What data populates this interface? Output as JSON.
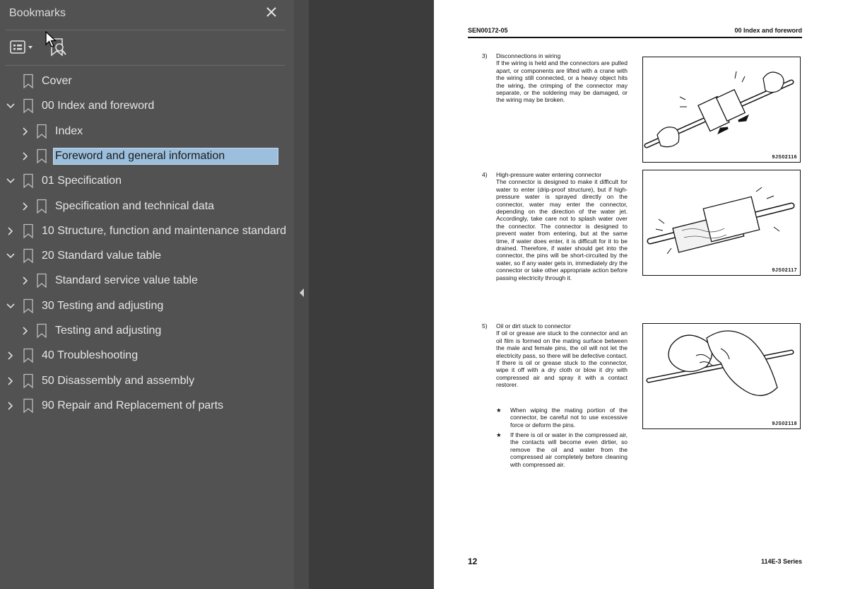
{
  "bookmarks_panel": {
    "title": "Bookmarks",
    "items": [
      {
        "label": "Cover",
        "level": 0,
        "expander": "none",
        "selected": false
      },
      {
        "label": "00 Index and foreword",
        "level": 0,
        "expander": "expanded",
        "selected": false
      },
      {
        "label": "Index",
        "level": 1,
        "expander": "collapsed",
        "selected": false
      },
      {
        "label": "Foreword and general information",
        "level": 1,
        "expander": "collapsed",
        "selected": true
      },
      {
        "label": "01 Specification",
        "level": 0,
        "expander": "expanded",
        "selected": false
      },
      {
        "label": "Specification and technical data",
        "level": 1,
        "expander": "collapsed",
        "selected": false
      },
      {
        "label": "10 Structure, function and maintenance standard",
        "level": 0,
        "expander": "collapsed",
        "selected": false
      },
      {
        "label": "20 Standard value table",
        "level": 0,
        "expander": "expanded",
        "selected": false
      },
      {
        "label": "Standard service value table",
        "level": 1,
        "expander": "collapsed",
        "selected": false
      },
      {
        "label": "30 Testing and adjusting",
        "level": 0,
        "expander": "expanded",
        "selected": false
      },
      {
        "label": "Testing and adjusting",
        "level": 1,
        "expander": "collapsed",
        "selected": false
      },
      {
        "label": "40 Troubleshooting",
        "level": 0,
        "expander": "collapsed",
        "selected": false
      },
      {
        "label": "50 Disassembly and assembly",
        "level": 0,
        "expander": "collapsed",
        "selected": false
      },
      {
        "label": "90 Repair and Replacement of parts",
        "level": 0,
        "expander": "collapsed",
        "selected": false
      }
    ]
  },
  "icons": {
    "close": "close-icon",
    "options": "list-options-icon",
    "find_bookmark": "find-bookmark-icon",
    "collapse": "caret-left-icon"
  },
  "colors": {
    "sidebar_bg": "#525252",
    "selection": "#9bbfdc",
    "page_bg": "#ffffff"
  },
  "document_page": {
    "header_left": "SEN00172-05",
    "header_right": "00 Index and foreword",
    "sections": [
      {
        "num": "3)",
        "title": "Disconnections in wiring",
        "body": "If the wiring is held and the connectors are pulled apart, or components are lifted with a crane with the wiring still connected, or a heavy object hits the wiring, the crimping of the connector may separate, or the soldering may be damaged, or the wiring may be broken.",
        "figure_code": "9JS02116"
      },
      {
        "num": "4)",
        "title": "High-pressure water entering connector",
        "body": "The connector is designed to make it difficult for water to enter (drip-proof structure), but if high-pressure water is sprayed directly on the connector, water may enter the connector, depending on the direction of the water jet. Accordingly, take care not to splash water over the connector. The connector is designed to prevent water from entering, but at the same time, if water does enter, it is difficult for it to be drained. Therefore, if water should get into the connector, the pins will be short-circuited by the water, so if any water gets in, immediately dry the connector or take other appropriate action before passing electricity through it.",
        "figure_code": "9JS02117"
      },
      {
        "num": "5)",
        "title": "Oil or dirt stuck to connector",
        "body": "If oil or grease are stuck to the connector and an oil film is formed on the mating surface between the male and female pins, the oil will not let the electricity pass, so there will be defective contact. If there is oil or grease stuck to the connector, wipe it off with a dry cloth or blow it dry with compressed air and spray it with a contact restorer.",
        "notes": [
          "When wiping the mating portion of the connector, be careful not to use excessive force or deform the pins.",
          "If there is oil or water in the compressed air, the contacts will become even dirtier, so remove the oil and water from the compressed air completely before cleaning with compressed air."
        ],
        "figure_code": "9JS02118"
      }
    ],
    "star_symbol": "★",
    "page_number": "12",
    "footer_right": "114E-3 Series"
  }
}
